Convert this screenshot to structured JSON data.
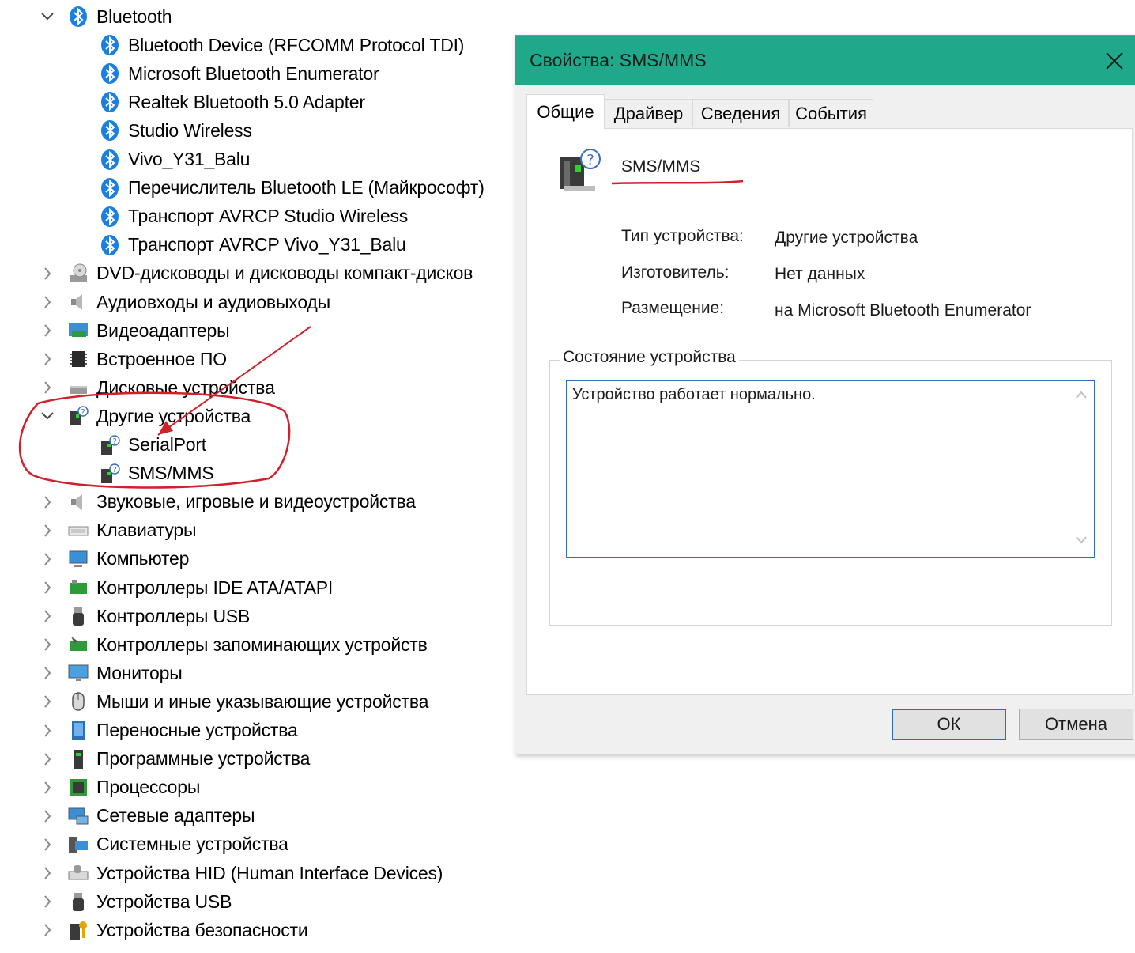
{
  "device_tree": {
    "bluetooth_group": {
      "label": "Bluetooth",
      "children": [
        "Bluetooth Device (RFCOMM Protocol TDI)",
        "Microsoft Bluetooth Enumerator",
        "Realtek Bluetooth 5.0 Adapter",
        "Studio Wireless",
        "Vivo_Y31_Balu",
        "Перечислитель Bluetooth LE (Майкрософт)",
        "Транспорт AVRCP Studio Wireless",
        "Транспорт AVRCP Vivo_Y31_Balu"
      ]
    },
    "categories_before": [
      {
        "label": "DVD-дисководы и дисководы компакт-дисков",
        "icon": "dvd-drive-icon"
      },
      {
        "label": "Аудиовходы и аудиовыходы",
        "icon": "speaker-icon"
      },
      {
        "label": "Видеоадаптеры",
        "icon": "display-adapter-icon"
      },
      {
        "label": "Встроенное ПО",
        "icon": "firmware-chip-icon"
      },
      {
        "label": "Дисковые устройства",
        "icon": "disk-drive-icon"
      }
    ],
    "other_group": {
      "label": "Другие устройства",
      "children": [
        "SerialPort",
        "SMS/MMS"
      ]
    },
    "categories_after": [
      {
        "label": "Звуковые, игровые и видеоустройства",
        "icon": "speaker-icon"
      },
      {
        "label": "Клавиатуры",
        "icon": "keyboard-icon"
      },
      {
        "label": "Компьютер",
        "icon": "computer-icon"
      },
      {
        "label": "Контроллеры IDE ATA/ATAPI",
        "icon": "ide-controller-icon"
      },
      {
        "label": "Контроллеры USB",
        "icon": "usb-icon"
      },
      {
        "label": "Контроллеры запоминающих устройств",
        "icon": "storage-controller-icon"
      },
      {
        "label": "Мониторы",
        "icon": "monitor-icon"
      },
      {
        "label": "Мыши и иные указывающие устройства",
        "icon": "mouse-icon"
      },
      {
        "label": "Переносные устройства",
        "icon": "portable-device-icon"
      },
      {
        "label": "Программные устройства",
        "icon": "software-device-icon"
      },
      {
        "label": "Процессоры",
        "icon": "processor-icon"
      },
      {
        "label": "Сетевые адаптеры",
        "icon": "network-adapter-icon"
      },
      {
        "label": "Системные устройства",
        "icon": "system-devices-icon"
      },
      {
        "label": "Устройства HID (Human Interface Devices)",
        "icon": "hid-icon"
      },
      {
        "label": "Устройства USB",
        "icon": "usb-icon"
      },
      {
        "label": "Устройства безопасности",
        "icon": "security-key-icon"
      }
    ]
  },
  "dialog": {
    "title": "Свойства: SMS/MMS",
    "tabs": [
      "Общие",
      "Драйвер",
      "Сведения",
      "События"
    ],
    "active_tab": "Общие",
    "device_name": "SMS/MMS",
    "fields": [
      {
        "label": "Тип устройства:",
        "value": "Другие устройства"
      },
      {
        "label": "Изготовитель:",
        "value": "Нет данных"
      },
      {
        "label": "Размещение:",
        "value": "на Microsoft Bluetooth Enumerator"
      }
    ],
    "status_group_title": "Состояние устройства",
    "status_text": "Устройство работает нормально.",
    "ok_label": "ОК",
    "cancel_label": "Отмена"
  },
  "colors": {
    "title_bar": "#1fa98a",
    "annotation_red": "#d0202a",
    "bluetooth_blue": "#1a7fe0",
    "focus_blue": "#2d6fbb"
  }
}
